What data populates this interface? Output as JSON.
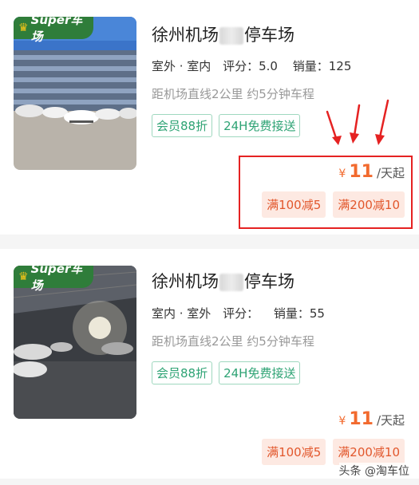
{
  "listings": [
    {
      "badge": "Super车场",
      "title_before": "徐州机场",
      "title_after": "停车场",
      "types": "室外 · 室内",
      "rating": "评分：5.0",
      "sales": "销量：125",
      "distance": "距机场直线2公里 约5分钟车程",
      "tags": [
        "会员88折",
        "24H免费接送"
      ],
      "price_symbol": "¥",
      "price": "11",
      "price_unit": "/天起",
      "coupons": [
        "满100减5",
        "满200减10"
      ]
    },
    {
      "badge": "Super车场",
      "title_before": "徐州机场",
      "title_after": "停车场",
      "types": "室内 · 室外",
      "rating": "评分：",
      "sales": "销量：55",
      "distance": "距机场直线2公里 约5分钟车程",
      "tags": [
        "会员88折",
        "24H免费接送"
      ],
      "price_symbol": "¥",
      "price": "11",
      "price_unit": "/天起",
      "coupons": [
        "满100减5",
        "满200减10"
      ]
    }
  ],
  "watermark": "头条 @淘车位",
  "colors": {
    "accent_green": "#2ea374",
    "price_orange": "#f26a2e",
    "coupon_bg": "#fde9e2",
    "highlight_red": "#e52222",
    "badge_green": "#2f7d3a"
  }
}
